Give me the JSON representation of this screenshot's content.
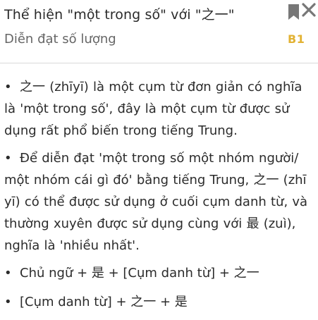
{
  "header": {
    "title": "Thể hiện \"một trong số\" với \"之一\"",
    "subtitle": "Diễn đạt số lượng",
    "level": "B1"
  },
  "icons": {
    "bookmark": "bookmark-icon",
    "close": "close-icon"
  },
  "colors": {
    "accent": "#e2b233",
    "icon": "#777777"
  },
  "content": {
    "paragraphs": [
      "之一 (zhīyī) là một cụm từ đơn giản có nghĩa là 'một trong số', đây là một cụm từ được sử dụng rất phổ biến trong tiếng Trung.",
      "Để diễn đạt 'một trong số một nhóm người/ một nhóm cái gì đó' bằng tiếng Trung, 之一 (zhī yī) có thể được sử dụng ở cuối cụm danh từ, và thường xuyên được sử dụng cùng với 最 (zuì), nghĩa là 'nhiều nhất'."
    ],
    "formulas": [
      "Chủ ngữ + 是 + [Cụm danh từ] + 之一",
      "[Cụm danh từ] + 之一 + 是"
    ],
    "bullet": "•"
  }
}
